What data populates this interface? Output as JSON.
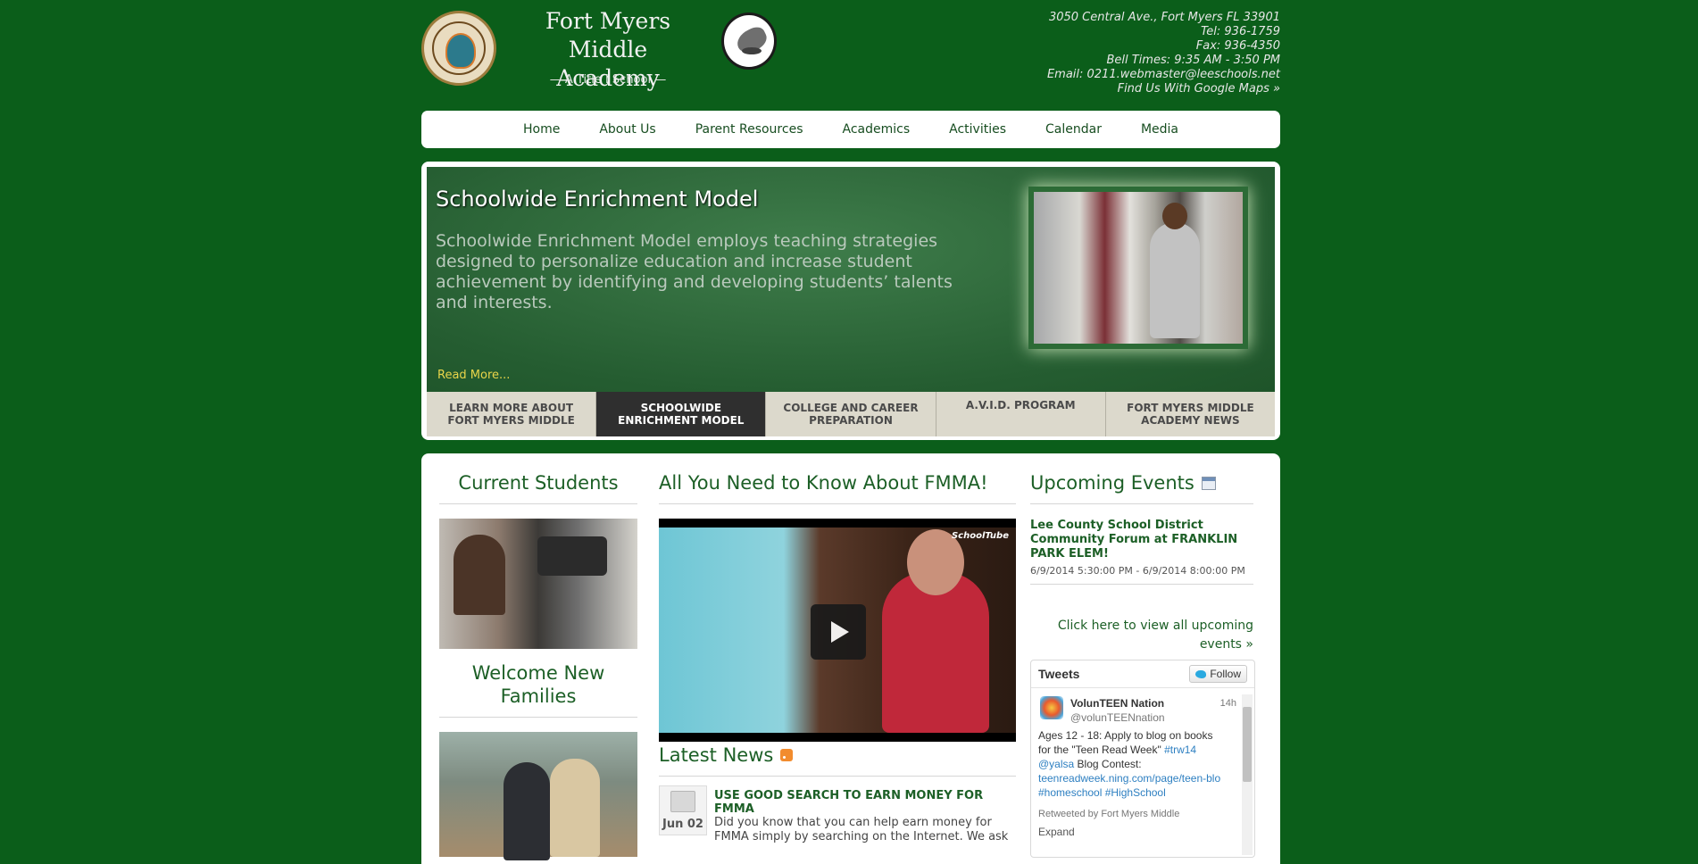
{
  "header": {
    "school_name_line1": "Fort Myers",
    "school_name_line2": "Middle Academy",
    "tagline": "— A Title I School —",
    "contact": {
      "address": "3050 Central Ave., Fort Myers FL 33901",
      "tel": "Tel: 936-1759",
      "fax": "Fax: 936-4350",
      "bell": "Bell Times: 9:35 AM - 3:50 PM",
      "email": "Email: 0211.webmaster@leeschools.net",
      "maps": "Find Us With Google Maps »"
    }
  },
  "nav": [
    "Home",
    "About Us",
    "Parent Resources",
    "Academics",
    "Activities",
    "Calendar",
    "Media"
  ],
  "feature": {
    "title": "Schoolwide Enrichment Model",
    "body": "Schoolwide Enrichment Model employs teaching strategies designed to personalize education and increase student achievement by identifying and developing students’ talents and interests.",
    "read_more": "Read More...",
    "tabs": [
      {
        "l1": "LEARN MORE ABOUT",
        "l2": "FORT MYERS MIDDLE"
      },
      {
        "l1": "SCHOOLWIDE",
        "l2": "ENRICHMENT MODEL"
      },
      {
        "l1": "COLLEGE AND CAREER",
        "l2": "PREPARATION"
      },
      {
        "l1": "A.V.I.D. PROGRAM",
        "l2": ""
      },
      {
        "l1": "FORT MYERS MIDDLE",
        "l2": "ACADEMY NEWS"
      }
    ],
    "active_tab": 1
  },
  "left": {
    "heading1": "Current Students",
    "heading2_line1": "Welcome New",
    "heading2_line2": "Families"
  },
  "middle": {
    "heading": "All You Need to Know About FMMA!",
    "video_watermark": "SchoolTube",
    "news_heading": "Latest News",
    "news": {
      "date": "Jun 02",
      "title": "USE GOOD SEARCH TO EARN MONEY FOR FMMA",
      "text": "Did you know that you can help earn money for FMMA simply by searching on the Internet. We ask"
    }
  },
  "right": {
    "heading": "Upcoming Events",
    "event_title": "Lee County School District Community Forum at FRANKLIN PARK ELEM!",
    "event_time": "6/9/2014 5:30:00 PM - 6/9/2014 8:00:00 PM",
    "all_events": "Click here to view all upcoming events »",
    "tweets": {
      "header": "Tweets",
      "follow": "Follow",
      "name": "VolunTEEN Nation",
      "handle": "@volunTEENnation",
      "time": "14h",
      "body_line1": "Ages 12 - 18:  Apply to blog on books",
      "body_line2": "for the \"Teen Read Week\"",
      "hashtag1": "#trw14",
      "mention": "@yalsa",
      "body_line3": "Blog Contest:",
      "link": "teenreadweek.ning.com/page/teen-blo",
      "hashtags2": "#homeschool #HighSchool",
      "retweet": "Retweeted by Fort Myers Middle",
      "expand": "Expand"
    }
  }
}
